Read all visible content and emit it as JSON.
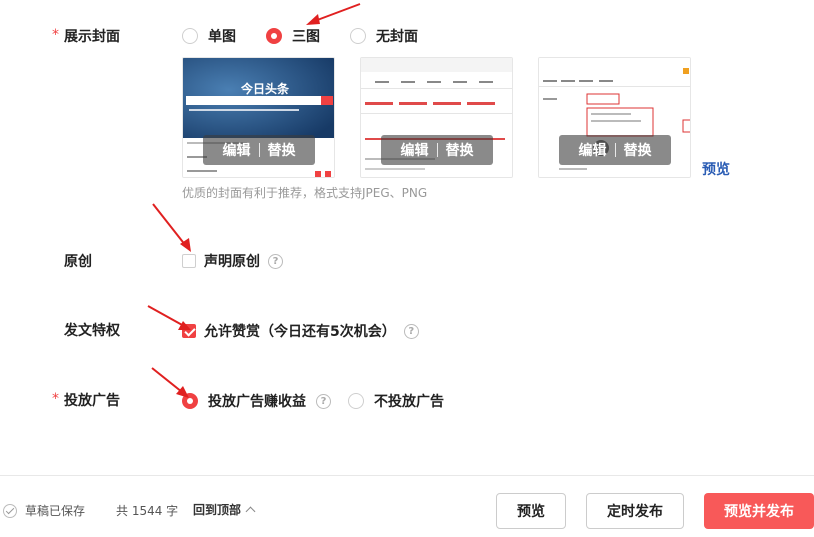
{
  "cover": {
    "label": "展示封面",
    "required_mark": "*",
    "options": [
      {
        "label": "单图",
        "checked": false
      },
      {
        "label": "三图",
        "checked": true
      },
      {
        "label": "无封面",
        "checked": false
      }
    ],
    "thumbs": [
      {
        "edit": "编辑",
        "replace": "替换",
        "headline": "今日头条"
      },
      {
        "edit": "编辑",
        "replace": "替换"
      },
      {
        "edit": "编辑",
        "replace": "替换"
      }
    ],
    "preview": "预览",
    "hint": "优质的封面有利于推荐，格式支持JPEG、PNG"
  },
  "original": {
    "label": "原创",
    "checkbox_label": "声明原创",
    "checked": false
  },
  "privilege": {
    "label": "发文特权",
    "checkbox_label": "允许赞赏（今日还有5次机会）",
    "checked": true
  },
  "ads": {
    "label": "投放广告",
    "required_mark": "*",
    "options": [
      {
        "label": "投放广告赚收益",
        "checked": true
      },
      {
        "label": "不投放广告",
        "checked": false
      }
    ]
  },
  "footer": {
    "saved": "草稿已保存",
    "count": "共 1544 字",
    "back_top": "回到顶部",
    "preview": "预览",
    "schedule": "定时发布",
    "publish": "预览并发布"
  },
  "colors": {
    "accent": "#f04142",
    "publish_button": "#f85959",
    "link": "#2a5cb4",
    "arrow": "#e02020"
  }
}
